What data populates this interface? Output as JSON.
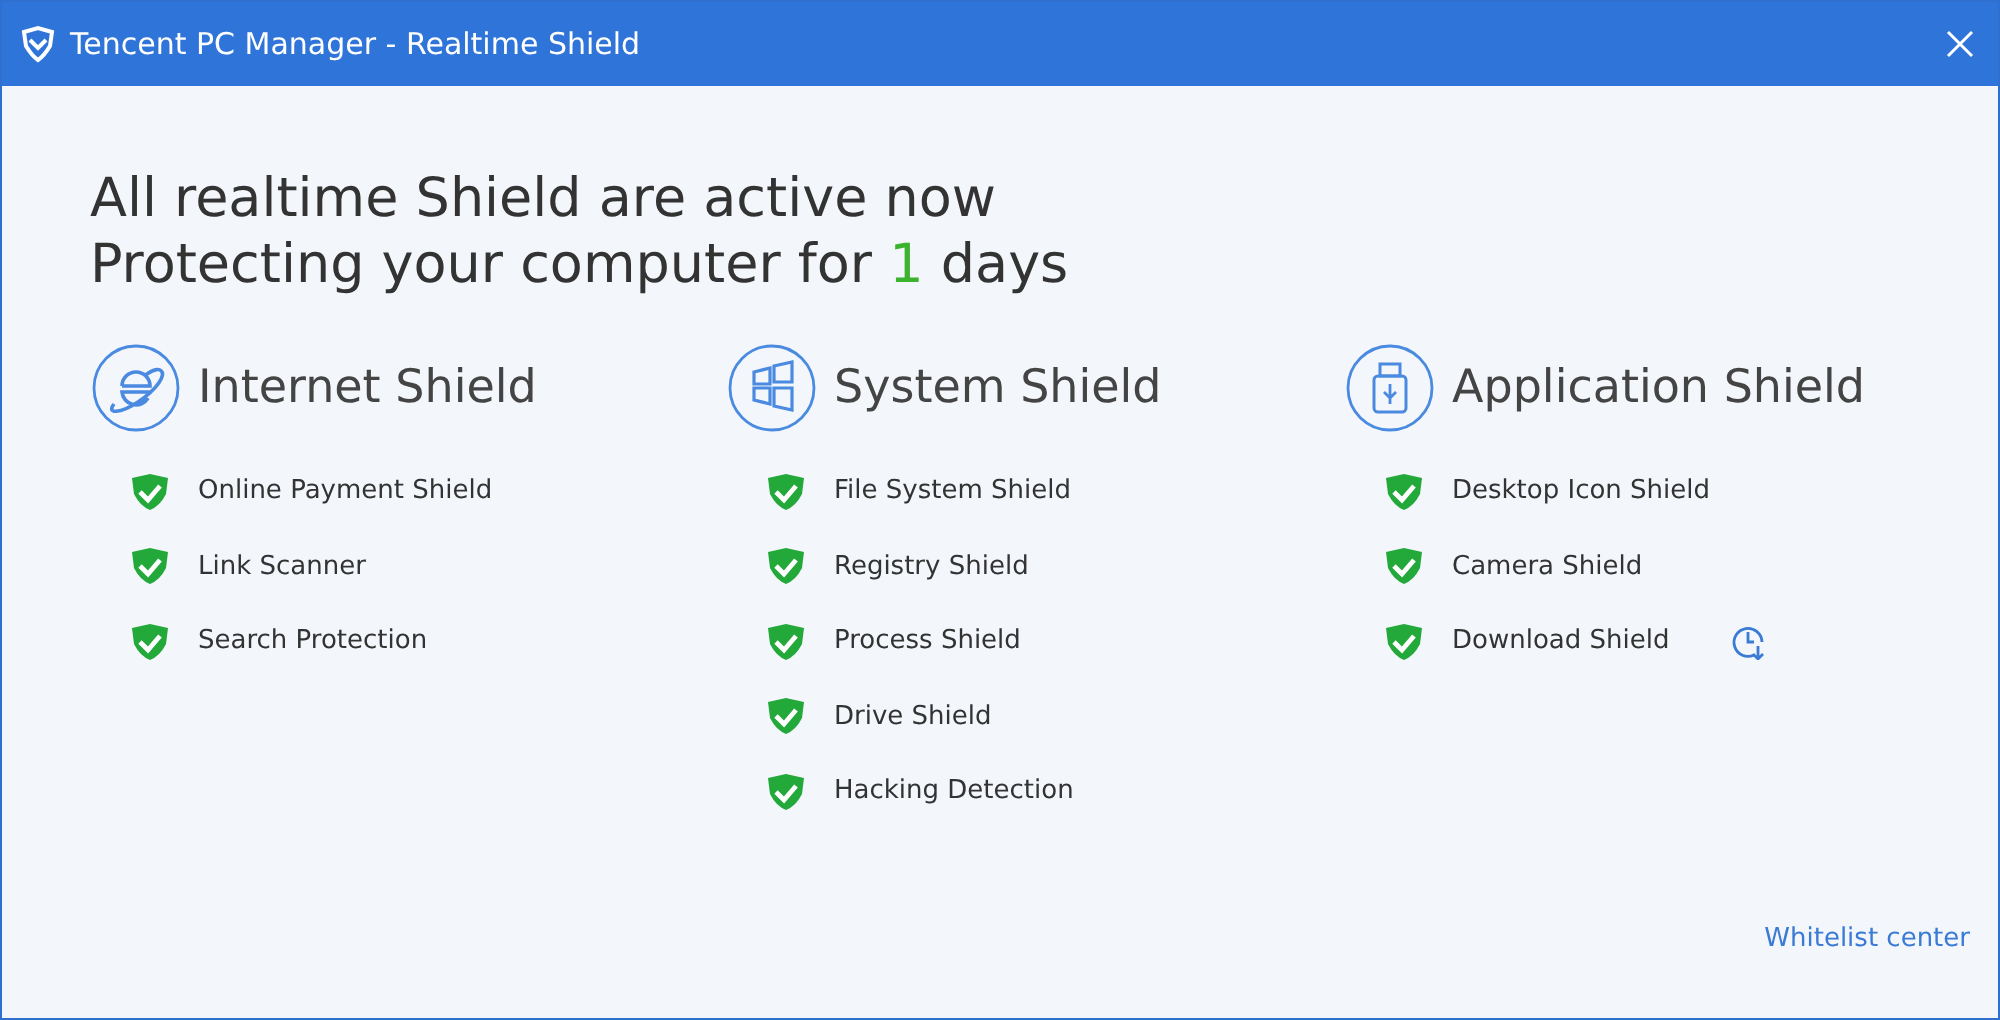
{
  "window": {
    "title": "Tencent PC Manager - Realtime Shield"
  },
  "headline": {
    "line1": "All realtime Shield are active now",
    "line2_before": "Protecting your computer for",
    "days": "1",
    "line2_after": "days"
  },
  "groups": [
    {
      "kind": "internet",
      "title": "Internet Shield",
      "items": [
        {
          "label": "Online Payment Shield",
          "active": true,
          "kind": "plain"
        },
        {
          "label": "Link Scanner",
          "active": true,
          "kind": "plain"
        },
        {
          "label": "Search Protection",
          "active": true,
          "kind": "plain"
        }
      ]
    },
    {
      "kind": "system",
      "title": "System Shield",
      "items": [
        {
          "label": "File System Shield",
          "active": true,
          "kind": "plain"
        },
        {
          "label": "Registry Shield",
          "active": true,
          "kind": "plain"
        },
        {
          "label": "Process Shield",
          "active": true,
          "kind": "plain"
        },
        {
          "label": "Drive Shield",
          "active": true,
          "kind": "plain"
        },
        {
          "label": "Hacking Detection",
          "active": true,
          "kind": "plain"
        }
      ]
    },
    {
      "kind": "application",
      "title": "Application Shield",
      "items": [
        {
          "label": "Desktop Icon Shield",
          "active": true,
          "kind": "plain"
        },
        {
          "label": "Camera Shield",
          "active": true,
          "kind": "plain"
        },
        {
          "label": "Download Shield",
          "active": true,
          "kind": "scheduled"
        }
      ]
    }
  ],
  "footer_link": "Whitelist center"
}
